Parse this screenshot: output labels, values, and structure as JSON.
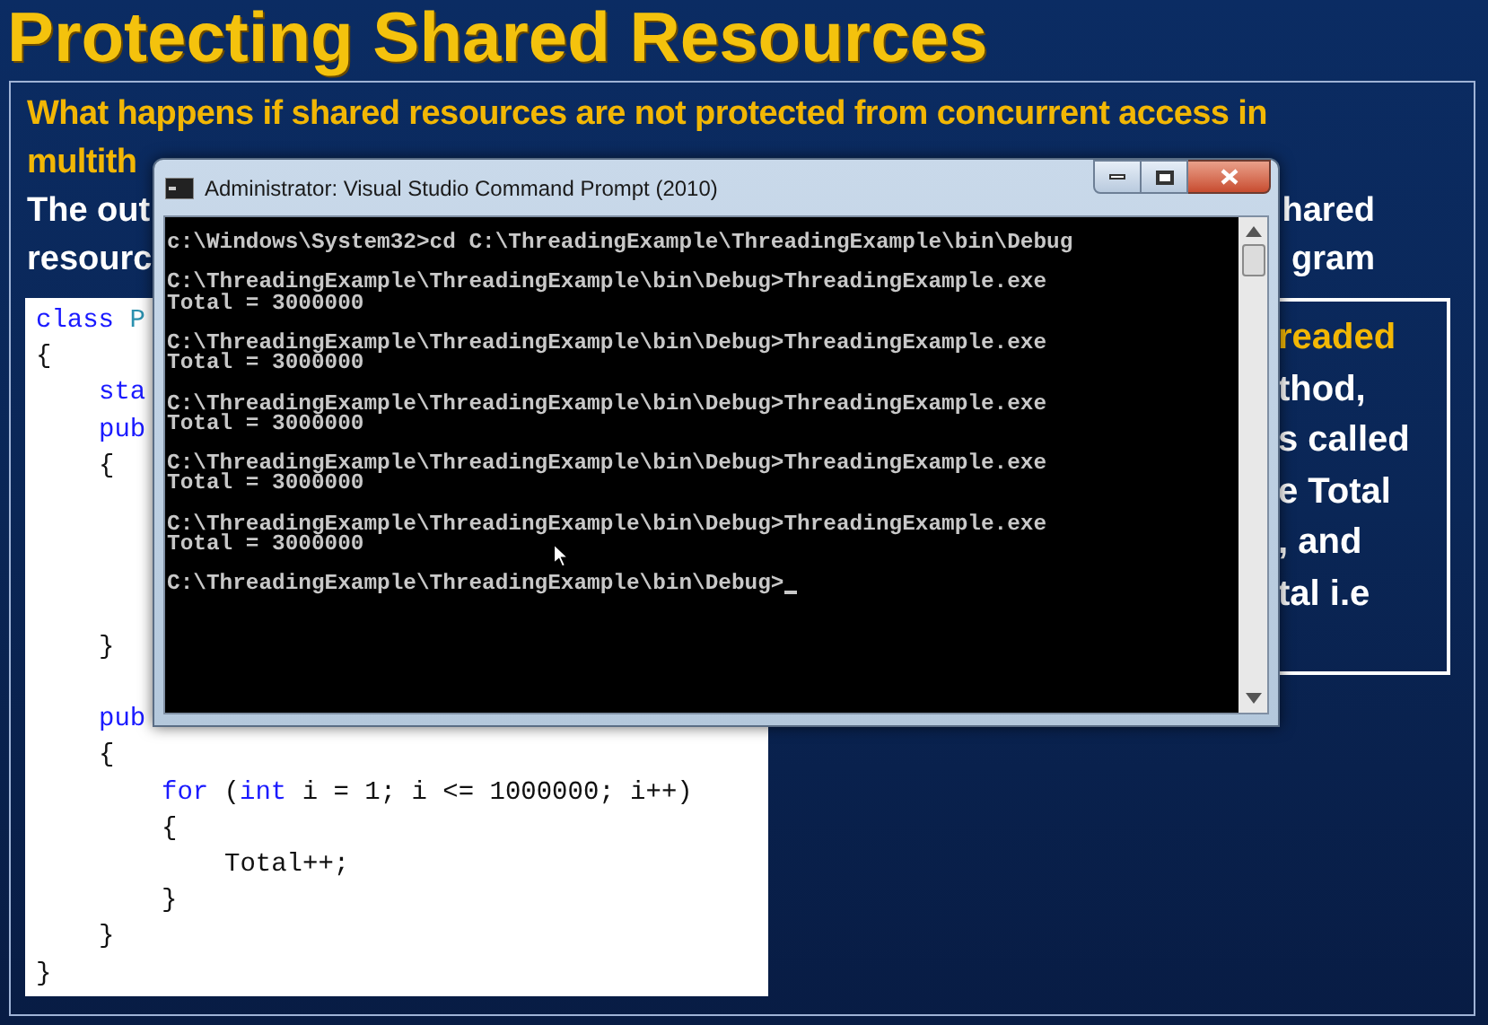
{
  "slide": {
    "title": "Protecting Shared Resources",
    "question": [
      "What happens if shared resources are not protected from concurrent access in",
      "multith"
    ],
    "body_rows": [
      {
        "left": "The out",
        "right": "hared"
      },
      {
        "left": "resourc",
        "right": "gram"
      }
    ],
    "code_lines": [
      {
        "kind": "line",
        "tokens": [
          {
            "text": "class",
            "kind": "keyword"
          },
          {
            "text": " P",
            "kind": "type"
          }
        ]
      },
      {
        "kind": "line",
        "tokens": [
          {
            "text": "{",
            "kind": "plain"
          }
        ],
        "children": [
          {
            "kind": "line",
            "tokens": [
              {
                "text": "sta",
                "kind": "keyword"
              }
            ]
          },
          {
            "kind": "line",
            "tokens": [
              {
                "text": "pub",
                "kind": "keyword"
              }
            ]
          },
          {
            "kind": "covered",
            "tokens": [
              {
                "text": "{",
                "kind": "plain"
              }
            ]
          },
          {
            "kind": "spaced",
            "tokens": [
              {
                "text": "}",
                "kind": "plain"
              }
            ]
          },
          {
            "kind": "line",
            "tokens": [
              {
                "text": "pub",
                "kind": "keyword"
              }
            ]
          },
          {
            "kind": "line",
            "tokens": [
              {
                "text": "{",
                "kind": "plain"
              }
            ],
            "children": [
              {
                "kind": "line",
                "tokens": [
                  {
                    "text": "for",
                    "kind": "keyword"
                  },
                  {
                    "text": " (",
                    "kind": "plain"
                  },
                  {
                    "text": "int",
                    "kind": "keyword"
                  },
                  {
                    "text": " i = 1; i <= 1000000; i++)",
                    "kind": "plain"
                  }
                ]
              },
              {
                "kind": "line",
                "tokens": [
                  {
                    "text": "{",
                    "kind": "plain"
                  }
                ],
                "children": [
                  {
                    "kind": "line",
                    "tokens": [
                      {
                        "text": "Total++;",
                        "kind": "plain"
                      }
                    ]
                  }
                ]
              },
              {
                "kind": "line",
                "tokens": [
                  {
                    "text": "}",
                    "kind": "plain"
                  }
                ]
              }
            ]
          },
          {
            "kind": "line",
            "tokens": [
              {
                "text": "}",
                "kind": "plain"
              }
            ]
          }
        ]
      },
      {
        "kind": "line",
        "tokens": [
          {
            "text": "}",
            "kind": "plain"
          }
        ]
      }
    ],
    "side_box": [
      {
        "text": "readed",
        "kind": "highlight"
      },
      {
        "text": "thod,",
        "kind": "plain"
      },
      {
        "text": "s called",
        "kind": "plain"
      },
      {
        "text": "e Total",
        "kind": "plain"
      },
      {
        "text": ", and",
        "kind": "plain"
      },
      {
        "text": "tal i.e",
        "kind": "plain"
      }
    ]
  },
  "console": {
    "title": "Administrator: Visual Studio Command Prompt (2010)",
    "blocks": [
      [
        "c:\\Windows\\System32>cd C:\\ThreadingExample\\ThreadingExample\\bin\\Debug"
      ],
      [
        "C:\\ThreadingExample\\ThreadingExample\\bin\\Debug>ThreadingExample.exe",
        "Total = 3000000"
      ],
      [
        "C:\\ThreadingExample\\ThreadingExample\\bin\\Debug>ThreadingExample.exe",
        "Total = 3000000"
      ],
      [
        "C:\\ThreadingExample\\ThreadingExample\\bin\\Debug>ThreadingExample.exe",
        "Total = 3000000"
      ],
      [
        "C:\\ThreadingExample\\ThreadingExample\\bin\\Debug>ThreadingExample.exe",
        "Total = 3000000"
      ],
      [
        "C:\\ThreadingExample\\ThreadingExample\\bin\\Debug>ThreadingExample.exe",
        "Total = 3000000"
      ],
      [
        "C:\\ThreadingExample\\ThreadingExample\\bin\\Debug>"
      ]
    ]
  }
}
